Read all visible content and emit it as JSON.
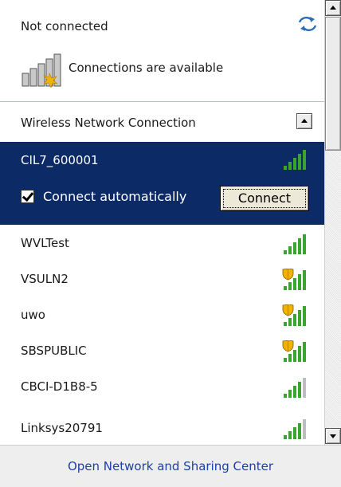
{
  "status": {
    "text": "Not connected",
    "refresh_icon": "refresh-arrows-icon"
  },
  "availability": {
    "text": "Connections are available",
    "icon": "network-available-icon"
  },
  "section": {
    "label": "Wireless Network Connection",
    "collapse_icon": "collapse-up-icon"
  },
  "selected_network": {
    "name": "CIL7_600001",
    "connect_automatically_label": "Connect automatically",
    "connect_automatically_checked": true,
    "connect_button": "Connect",
    "signal_bars": 5,
    "secured": false
  },
  "networks": [
    {
      "name": "WVLTest",
      "signal_bars": 5,
      "secured": false
    },
    {
      "name": "VSULN2",
      "signal_bars": 5,
      "secured": true
    },
    {
      "name": "uwo",
      "signal_bars": 5,
      "secured": true
    },
    {
      "name": "SBSPUBLIC",
      "signal_bars": 5,
      "secured": true
    },
    {
      "name": "CBCI-D1B8-5",
      "signal_bars": 4,
      "secured": false
    },
    {
      "name": "Linksys20791",
      "signal_bars": 4,
      "secured": false
    }
  ],
  "footer": {
    "link": "Open Network and Sharing Center"
  },
  "colors": {
    "selected_bg": "#0c2a66",
    "signal_green": "#3aa52e",
    "link": "#1c3fa8"
  }
}
